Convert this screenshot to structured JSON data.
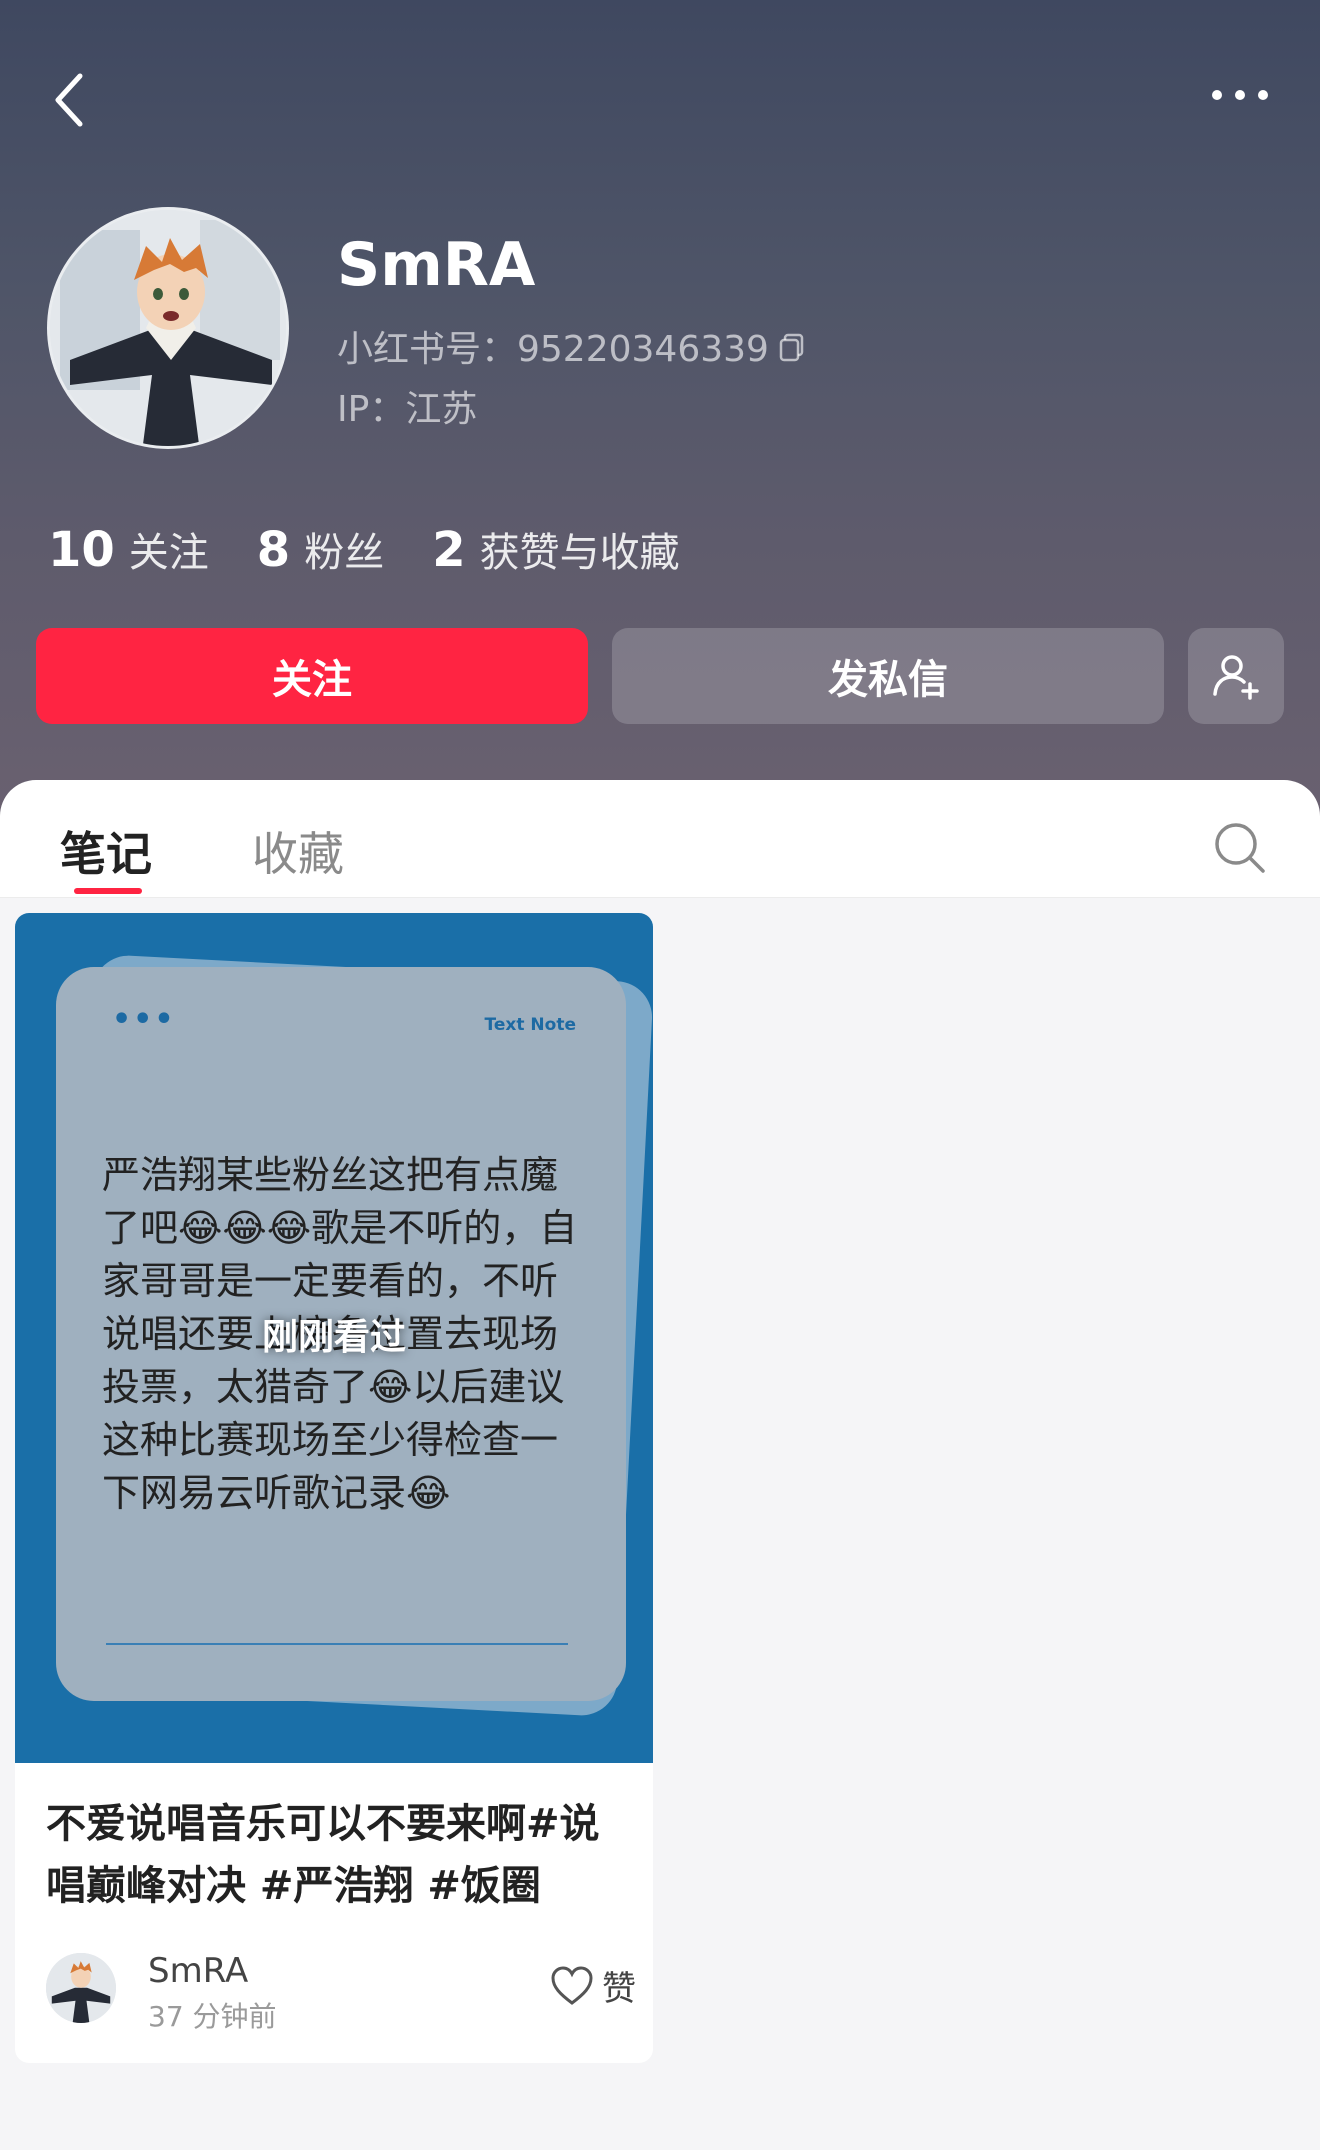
{
  "profile": {
    "username": "SmRA",
    "account_id": "小红书号：95220346339",
    "ip": "IP：江苏",
    "stats": [
      {
        "num": "10",
        "label": "关注"
      },
      {
        "num": "8",
        "label": "粉丝"
      },
      {
        "num": "2",
        "label": "获赞与收藏"
      }
    ]
  },
  "actions": {
    "follow": "关注",
    "message": "发私信"
  },
  "tabs": {
    "notes": "笔记",
    "collect": "收藏"
  },
  "note_card": {
    "cover_label": "Text Note",
    "cover_text": "严浩翔某些粉丝这把有点魔了吧😂😂😂歌是不听的，自家哥哥是一定要看的，不听说唱还要上榜多位置去现场投票，太猎奇了😂以后建议这种比赛现场至少得检查一下网易云听歌记录😂",
    "seen_overlay": "刚刚看过",
    "title": "不爱说唱音乐可以不要来啊#说唱巅峰对决 #严浩翔 #饭圈",
    "author": "SmRA",
    "time": "37 分钟前",
    "like_label": "赞"
  },
  "colors": {
    "accent": "#ff2442",
    "header_top": "#3f4860",
    "header_bottom": "#6a6170",
    "cover_bg": "#1a6fa8"
  },
  "icons": [
    "back-icon",
    "more-icon",
    "copy-icon",
    "add-user-icon",
    "search-icon",
    "heart-icon"
  ]
}
